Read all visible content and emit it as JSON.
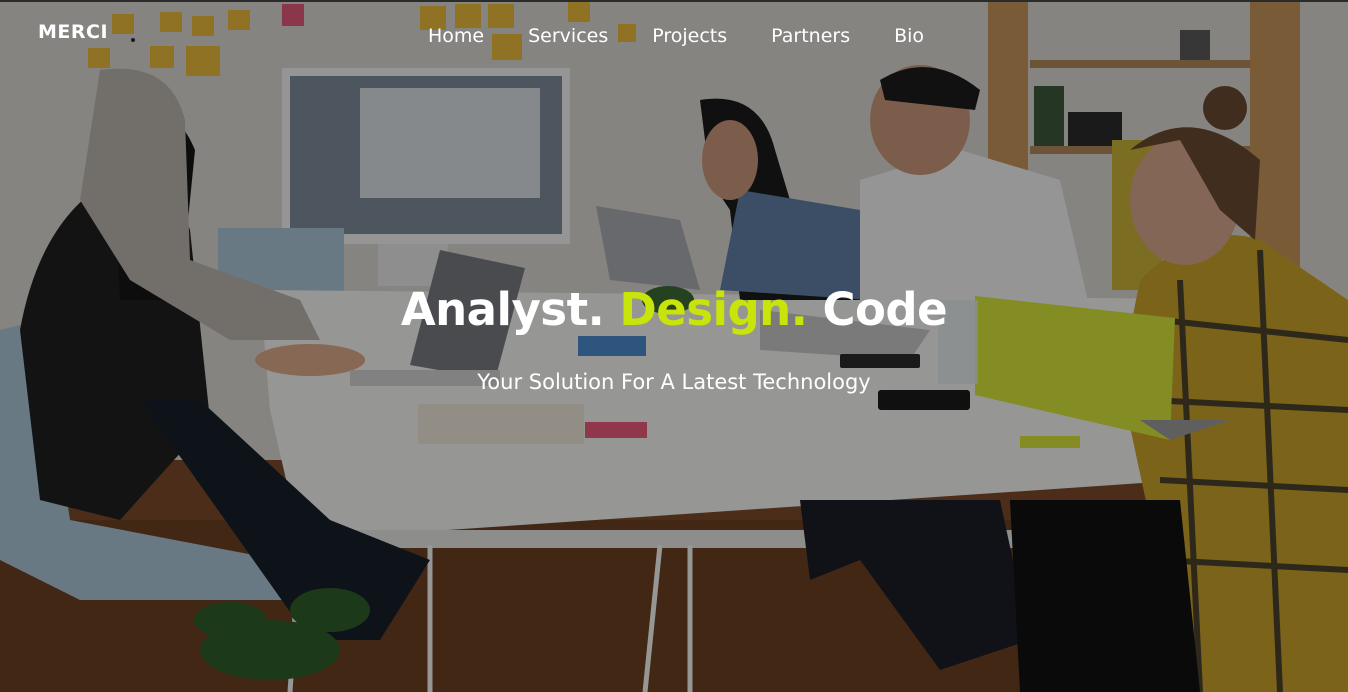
{
  "brand": {
    "name": "MERCI"
  },
  "nav": {
    "items": [
      {
        "label": "Home"
      },
      {
        "label": "Services"
      },
      {
        "label": "Projects"
      },
      {
        "label": "Partners"
      },
      {
        "label": "Bio"
      }
    ]
  },
  "hero": {
    "headline_part1": "Analyst.",
    "headline_part2": "Design.",
    "headline_part3": "Code",
    "subtitle": "Your Solution For A Latest Technology",
    "accent_color": "#c9e40a"
  }
}
